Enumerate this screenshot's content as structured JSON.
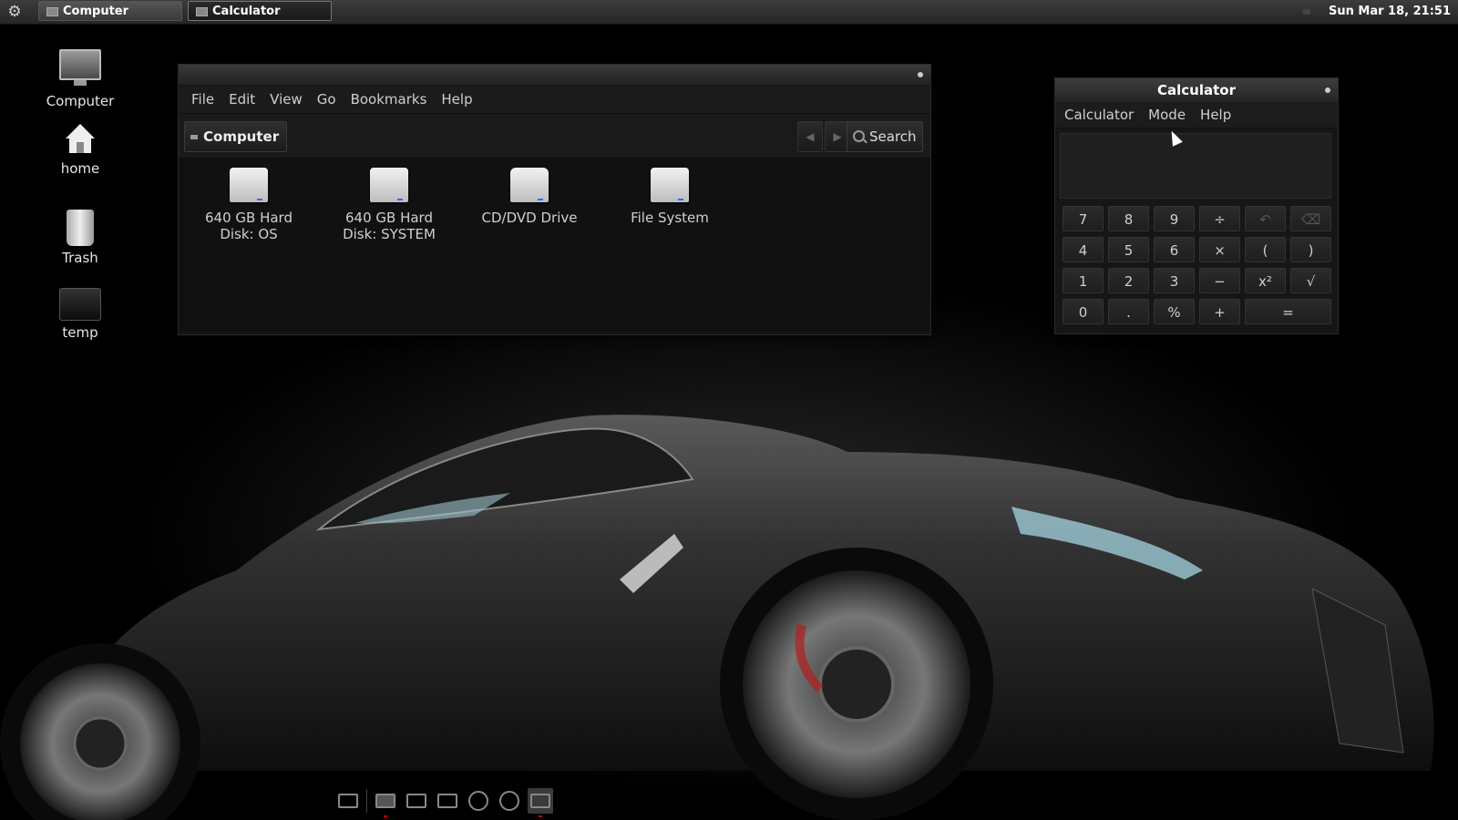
{
  "top_panel": {
    "tasks": [
      {
        "label": "Computer"
      },
      {
        "label": "Calculator"
      }
    ],
    "clock": "Sun Mar 18, 21:51"
  },
  "desktop": {
    "icons": [
      {
        "label": "Computer",
        "icon": "computer-icon"
      },
      {
        "label": "home",
        "icon": "home-icon"
      },
      {
        "label": "Trash",
        "icon": "trash-icon"
      },
      {
        "label": "temp",
        "icon": "folder-icon"
      }
    ]
  },
  "file_manager": {
    "menu": [
      "File",
      "Edit",
      "View",
      "Go",
      "Bookmarks",
      "Help"
    ],
    "location": "Computer",
    "search_label": "Search",
    "items": [
      {
        "label": "640 GB Hard Disk: OS"
      },
      {
        "label": "640 GB Hard Disk: SYSTEM"
      },
      {
        "label": "CD/DVD Drive"
      },
      {
        "label": "File System"
      }
    ]
  },
  "calculator": {
    "title": "Calculator",
    "menu": [
      "Calculator",
      "Mode",
      "Help"
    ],
    "display": "",
    "keys": [
      [
        "7",
        "8",
        "9",
        "÷",
        "↶",
        "⌫"
      ],
      [
        "4",
        "5",
        "6",
        "×",
        "(",
        ")"
      ],
      [
        "1",
        "2",
        "3",
        "−",
        "x²",
        "√"
      ],
      [
        "0",
        ".",
        "%",
        "+",
        "="
      ]
    ]
  },
  "dock": {
    "items": [
      "show-desktop-icon",
      "file-manager-icon",
      "screenshot-icon",
      "terminal-icon",
      "firefox-icon",
      "chrome-icon",
      "calculator-icon"
    ]
  },
  "colors": {
    "panel": "#262626",
    "window_bg": "#141414",
    "accent_running": "#cc0000"
  }
}
